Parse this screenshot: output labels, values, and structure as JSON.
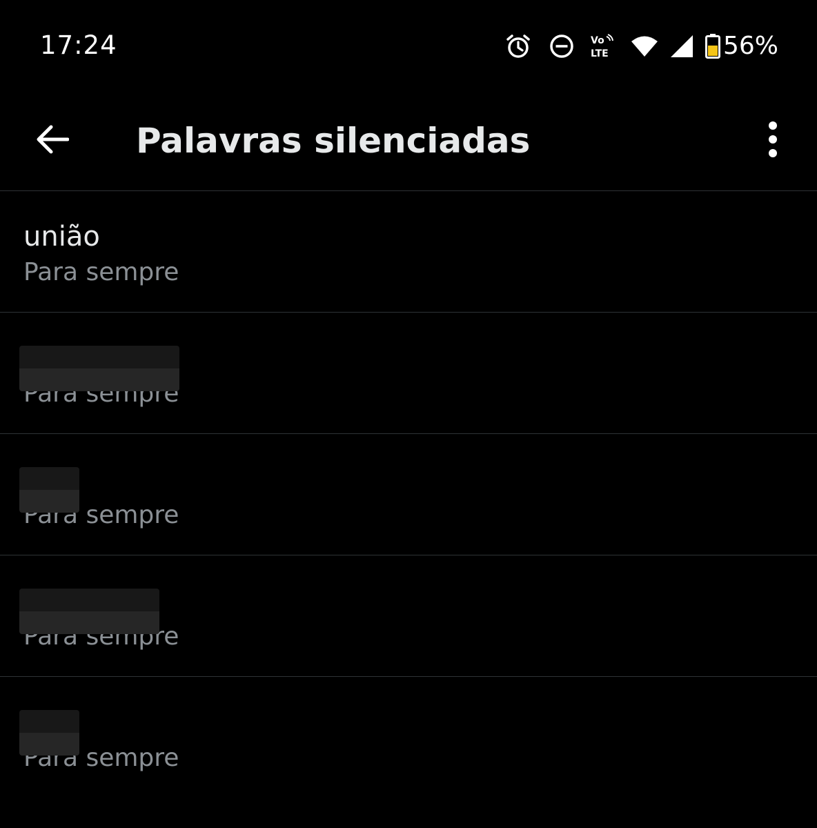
{
  "status_bar": {
    "time": "17:24",
    "volte_top": "Vo",
    "volte_bottom": "LTE",
    "battery_percent": "56%",
    "battery_level": 0.56,
    "icons": [
      "alarm-icon",
      "dnd-icon",
      "volte-icon",
      "wifi-icon",
      "signal-icon",
      "battery-icon"
    ]
  },
  "app_bar": {
    "title": "Palavras silenciadas",
    "back_icon": "arrow-left-icon",
    "more_icon": "more-vertical-icon"
  },
  "muted_words": [
    {
      "word": "união",
      "duration": "Para sempre",
      "redacted": false
    },
    {
      "word": "",
      "duration": "Para sempre",
      "redacted": true
    },
    {
      "word": "",
      "duration": "Para sempre",
      "redacted": true
    },
    {
      "word": "",
      "duration": "Para sempre",
      "redacted": true
    },
    {
      "word": "",
      "duration": "Para sempre",
      "redacted": true
    }
  ],
  "colors": {
    "background": "#000000",
    "primary_text": "#e7e9ea",
    "secondary_text": "#8b9095",
    "divider": "#2f3336",
    "battery_fill": "#f5c518"
  }
}
